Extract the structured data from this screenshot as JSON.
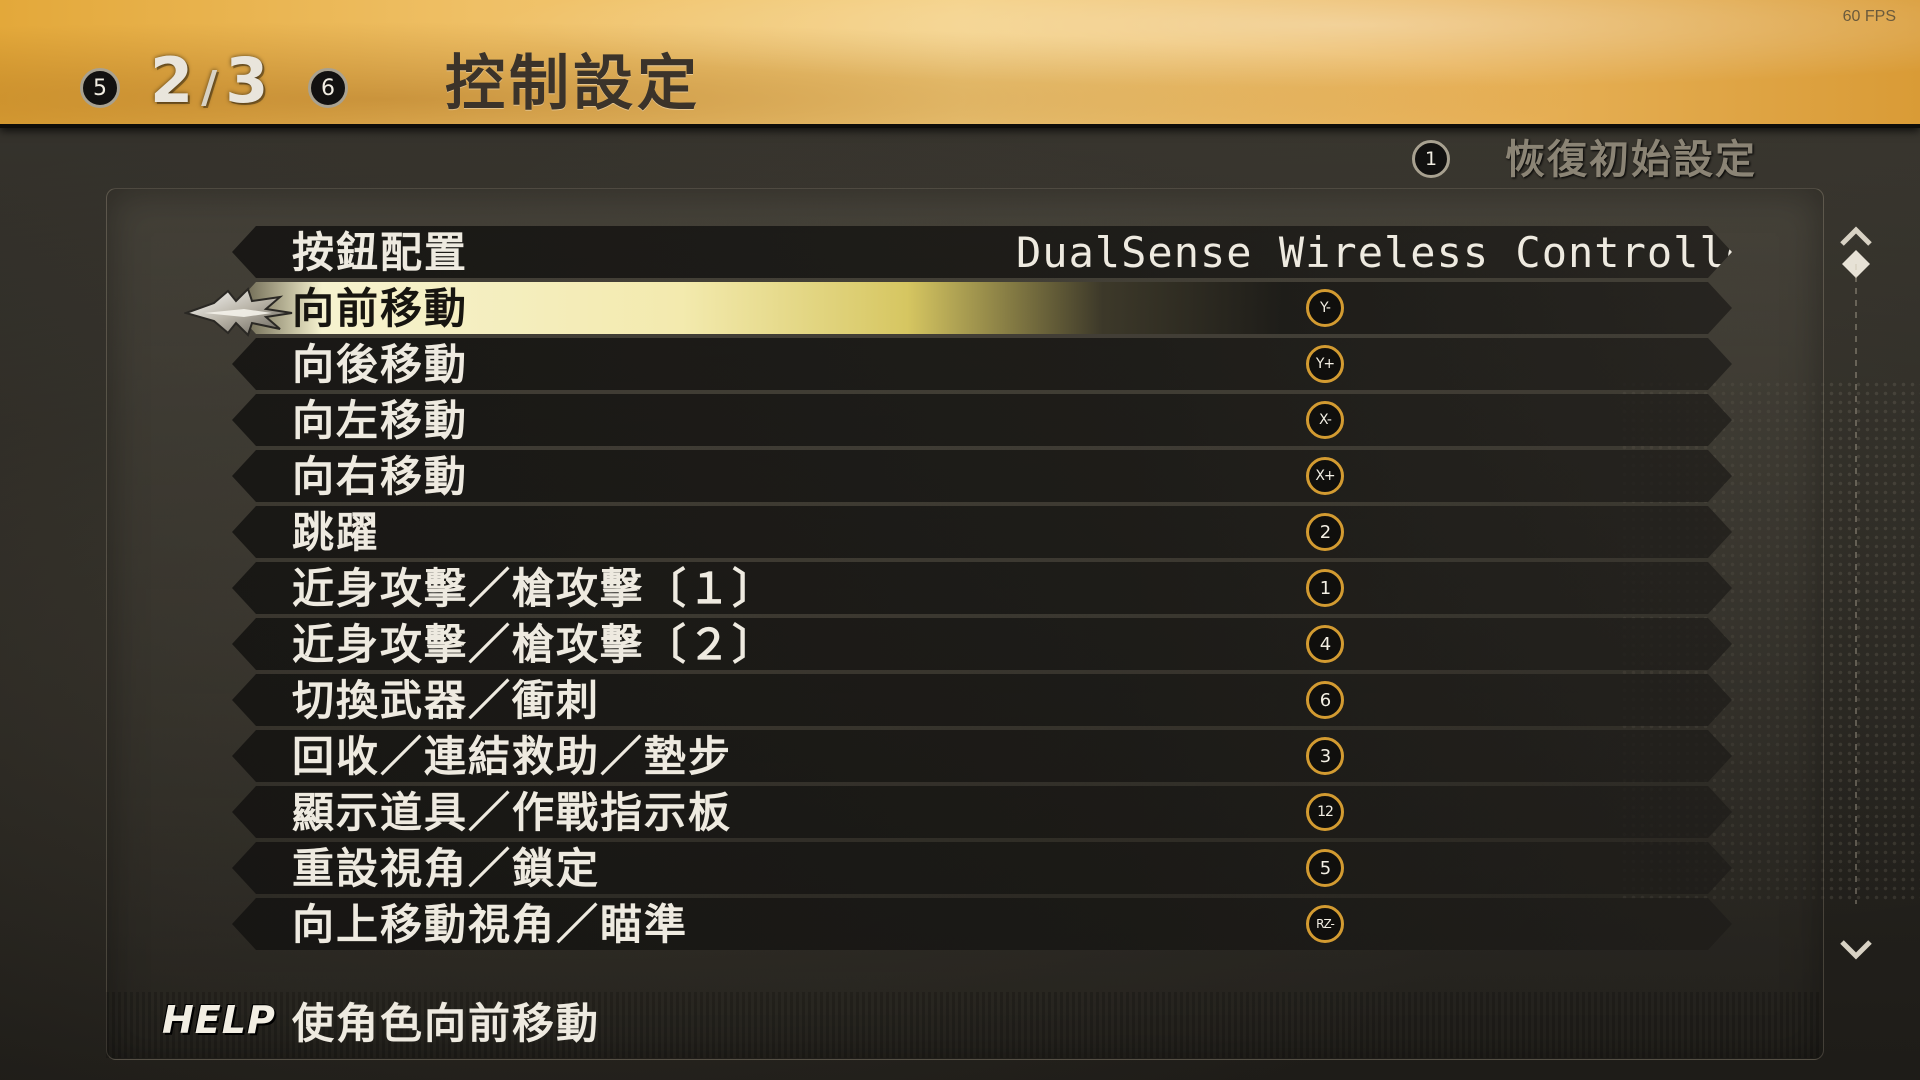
{
  "status": {
    "fps": "60 FPS"
  },
  "header": {
    "prev_page_button": "5",
    "next_page_button": "6",
    "page_current": "2",
    "page_separator": "/",
    "page_total": "3",
    "title": "控制設定"
  },
  "restore": {
    "button": "1",
    "label": "恢復初始設定"
  },
  "controller": {
    "label": "按鈕配置",
    "value": "DualSense Wireless Controller"
  },
  "bindings": [
    {
      "label": "向前移動",
      "button": "Y-",
      "selected": true
    },
    {
      "label": "向後移動",
      "button": "Y+"
    },
    {
      "label": "向左移動",
      "button": "X-"
    },
    {
      "label": "向右移動",
      "button": "X+"
    },
    {
      "label": "跳躍",
      "button": "2"
    },
    {
      "label": "近身攻擊／槍攻擊〔１〕",
      "button": "1"
    },
    {
      "label": "近身攻擊／槍攻擊〔２〕",
      "button": "4"
    },
    {
      "label": "切換武器／衝刺",
      "button": "6"
    },
    {
      "label": "回收／連結救助／墊步",
      "button": "3"
    },
    {
      "label": "顯示道具／作戰指示板",
      "button": "12"
    },
    {
      "label": "重設視角／鎖定",
      "button": "5"
    },
    {
      "label": "向上移動視角／瞄準",
      "button": "RZ-"
    }
  ],
  "help": {
    "tag": "HELP",
    "text": "使角色向前移動"
  },
  "colors": {
    "header_gold": "#efc066",
    "selected_highlight": "#f3eaae",
    "binding_ring": "#d39b31",
    "panel_dark": "#181714"
  },
  "icons": {
    "cursor": "winged-cursor-icon",
    "scroll_up": "chevron-up-icon",
    "scroll_thumb": "diamond-icon",
    "scroll_down": "chevron-down-icon"
  }
}
